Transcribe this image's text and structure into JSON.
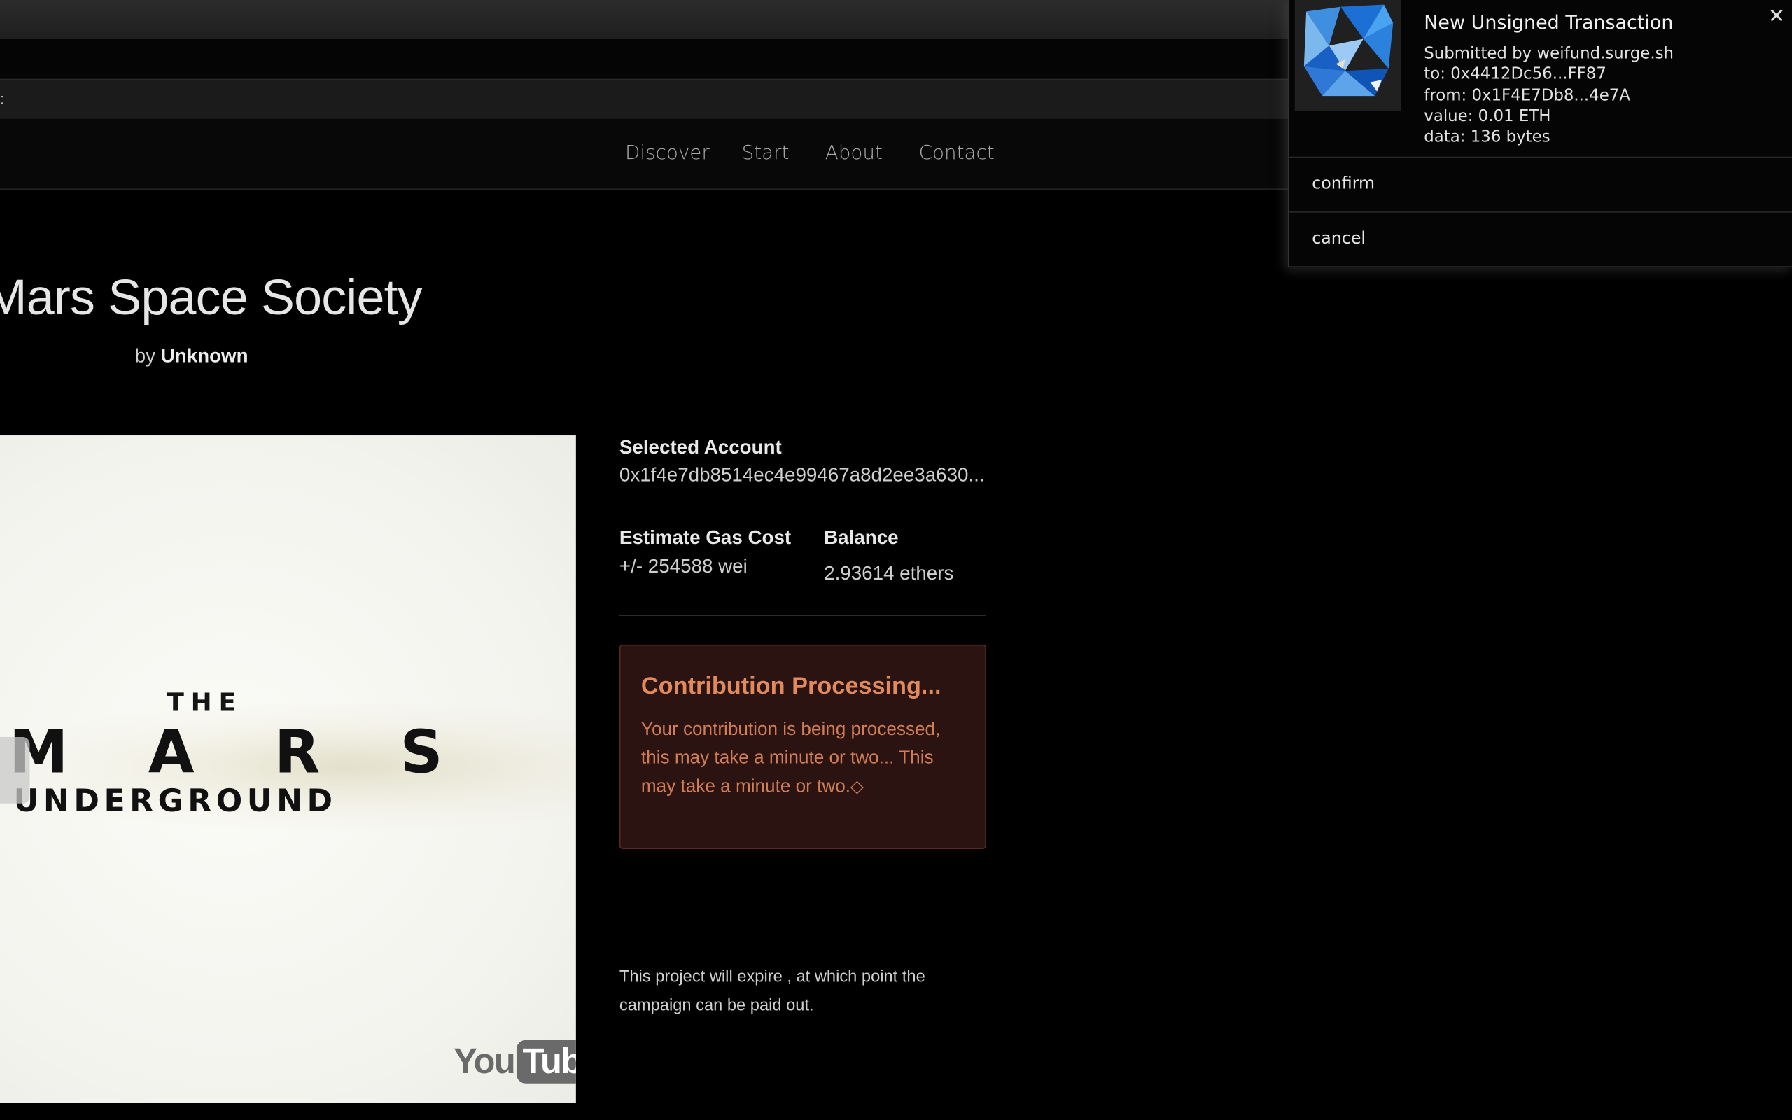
{
  "nav": {
    "items": [
      "Discover",
      "Start",
      "About",
      "Contact"
    ]
  },
  "campaign": {
    "title": "Mars Space Society",
    "by_prefix": "by",
    "author": "Unknown"
  },
  "video": {
    "the_text": "THE",
    "mars_text": "MARS",
    "underground_text": "UNDERGROUND",
    "youtube_you": "You",
    "youtube_tube": "Tube",
    "icon": "youtube-logo"
  },
  "account": {
    "selected_label": "Selected Account",
    "selected_value": "0x1f4e7db8514ec4e99467a8d2ee3a630...",
    "gas_label": "Estimate Gas Cost",
    "gas_value": "+/- 254588 wei",
    "balance_label": "Balance",
    "balance_value": "2.93614 ethers"
  },
  "alert": {
    "title": "Contribution Processing...",
    "body": "Your contribution is being processed, this may take a minute or two... This may take a minute or two.",
    "trailing_glyph": "◇",
    "accent_color": "#e08a5e",
    "background_color": "#2a1310"
  },
  "expire_text": "This project will expire , at which point the campaign can be paid out.",
  "notification": {
    "icon": "metamask-fox-icon",
    "close_glyph": "✕",
    "title": "New Unsigned Transaction",
    "submitted_by": "Submitted by weifund.surge.sh",
    "to": "to: 0x4412Dc56...FF87",
    "from": "from: 0x1F4E7Db8...4e7A",
    "value": "value: 0.01 ETH",
    "data": "data: 136 bytes",
    "confirm_label": "confirm",
    "cancel_label": "cancel"
  }
}
